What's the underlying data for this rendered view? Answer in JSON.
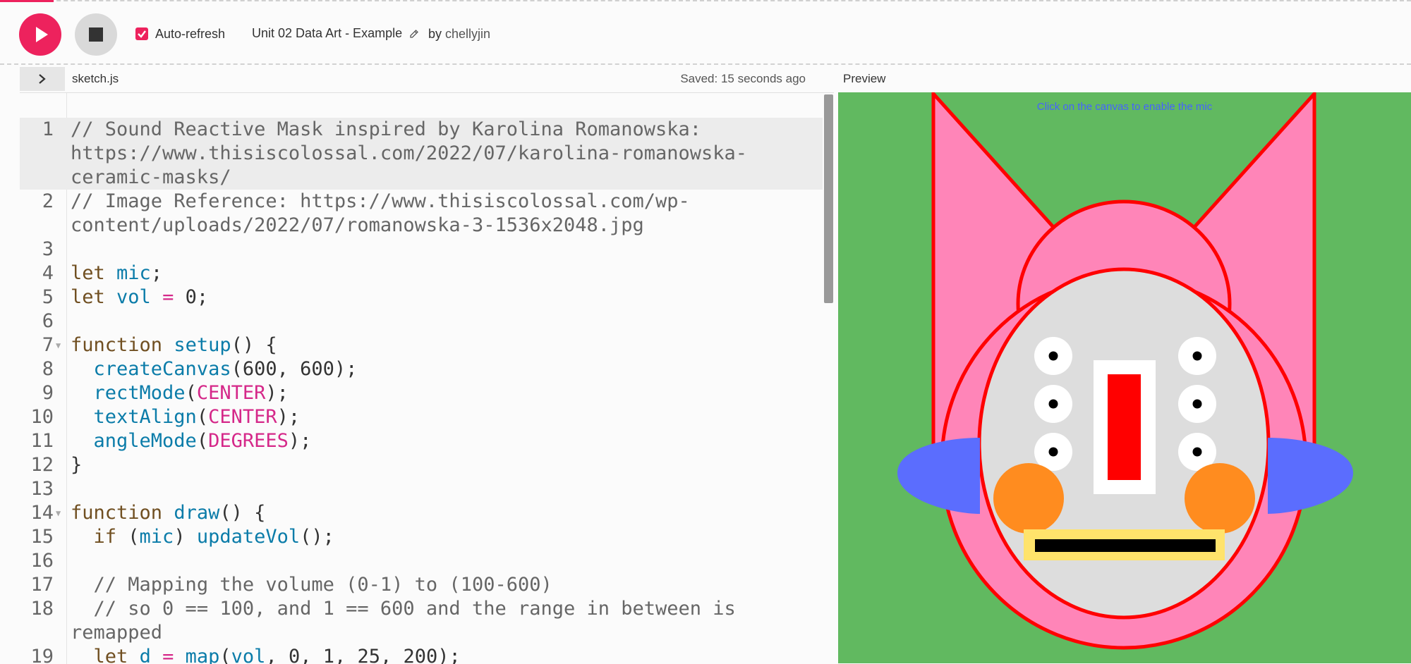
{
  "toolbar": {
    "auto_refresh_label": "Auto-refresh",
    "auto_refresh_checked": true,
    "project_title": "Unit 02 Data Art - Example",
    "by_label": "by",
    "author": "chellyjin",
    "colors": {
      "accent": "#ed225d",
      "stop_bg": "#d9d9d9"
    }
  },
  "editor": {
    "file_name": "sketch.js",
    "saved_status": "Saved: 15 seconds ago",
    "lines": [
      {
        "n": "1",
        "tokens": [
          {
            "t": "// Sound Reactive Mask inspired by Karolina Romanowska: https://www.thisiscolossal.com/2022/07/karolina-romanowska-ceramic-masks/",
            "c": "com"
          }
        ]
      },
      {
        "n": "2",
        "tokens": [
          {
            "t": "// Image Reference: https://www.thisiscolossal.com/wp-content/uploads/2022/07/romanowska-3-1536x2048.jpg",
            "c": "com"
          }
        ]
      },
      {
        "n": "3",
        "tokens": []
      },
      {
        "n": "4",
        "tokens": [
          {
            "t": "let",
            "c": "kw"
          },
          {
            "t": " ",
            "c": "txt"
          },
          {
            "t": "mic",
            "c": "var"
          },
          {
            "t": ";",
            "c": "txt"
          }
        ]
      },
      {
        "n": "5",
        "tokens": [
          {
            "t": "let",
            "c": "kw"
          },
          {
            "t": " ",
            "c": "txt"
          },
          {
            "t": "vol",
            "c": "var"
          },
          {
            "t": " ",
            "c": "txt"
          },
          {
            "t": "=",
            "c": "op"
          },
          {
            "t": " 0;",
            "c": "txt"
          }
        ]
      },
      {
        "n": "6",
        "tokens": []
      },
      {
        "n": "7",
        "fold": true,
        "tokens": [
          {
            "t": "function",
            "c": "kw"
          },
          {
            "t": " ",
            "c": "txt"
          },
          {
            "t": "setup",
            "c": "fn"
          },
          {
            "t": "() {",
            "c": "txt"
          }
        ]
      },
      {
        "n": "8",
        "tokens": [
          {
            "t": "  ",
            "c": "txt"
          },
          {
            "t": "createCanvas",
            "c": "fn"
          },
          {
            "t": "(600, 600);",
            "c": "txt"
          }
        ]
      },
      {
        "n": "9",
        "tokens": [
          {
            "t": "  ",
            "c": "txt"
          },
          {
            "t": "rectMode",
            "c": "fn"
          },
          {
            "t": "(",
            "c": "txt"
          },
          {
            "t": "CENTER",
            "c": "const"
          },
          {
            "t": ");",
            "c": "txt"
          }
        ]
      },
      {
        "n": "10",
        "tokens": [
          {
            "t": "  ",
            "c": "txt"
          },
          {
            "t": "textAlign",
            "c": "fn"
          },
          {
            "t": "(",
            "c": "txt"
          },
          {
            "t": "CENTER",
            "c": "const"
          },
          {
            "t": ");",
            "c": "txt"
          }
        ]
      },
      {
        "n": "11",
        "tokens": [
          {
            "t": "  ",
            "c": "txt"
          },
          {
            "t": "angleMode",
            "c": "fn"
          },
          {
            "t": "(",
            "c": "txt"
          },
          {
            "t": "DEGREES",
            "c": "const"
          },
          {
            "t": ");",
            "c": "txt"
          }
        ]
      },
      {
        "n": "12",
        "tokens": [
          {
            "t": "}",
            "c": "txt"
          }
        ]
      },
      {
        "n": "13",
        "tokens": []
      },
      {
        "n": "14",
        "fold": true,
        "tokens": [
          {
            "t": "function",
            "c": "kw"
          },
          {
            "t": " ",
            "c": "txt"
          },
          {
            "t": "draw",
            "c": "fn"
          },
          {
            "t": "() {",
            "c": "txt"
          }
        ]
      },
      {
        "n": "15",
        "tokens": [
          {
            "t": "  ",
            "c": "txt"
          },
          {
            "t": "if",
            "c": "kw"
          },
          {
            "t": " (",
            "c": "txt"
          },
          {
            "t": "mic",
            "c": "var"
          },
          {
            "t": ") ",
            "c": "txt"
          },
          {
            "t": "updateVol",
            "c": "fn"
          },
          {
            "t": "();",
            "c": "txt"
          }
        ]
      },
      {
        "n": "16",
        "tokens": []
      },
      {
        "n": "17",
        "tokens": [
          {
            "t": "  // Mapping the volume (0-1) to (100-600)",
            "c": "com"
          }
        ]
      },
      {
        "n": "18",
        "tokens": [
          {
            "t": "  // so 0 == 100, and 1 == 600 and the range in between is remapped",
            "c": "com"
          }
        ]
      },
      {
        "n": "19",
        "tokens": [
          {
            "t": "  ",
            "c": "txt"
          },
          {
            "t": "let",
            "c": "kw"
          },
          {
            "t": " ",
            "c": "txt"
          },
          {
            "t": "d",
            "c": "var"
          },
          {
            "t": " ",
            "c": "txt"
          },
          {
            "t": "=",
            "c": "op"
          },
          {
            "t": " ",
            "c": "txt"
          },
          {
            "t": "map",
            "c": "fn"
          },
          {
            "t": "(",
            "c": "txt"
          },
          {
            "t": "vol",
            "c": "var"
          },
          {
            "t": ", 0, 1, 25, 200);",
            "c": "txt"
          }
        ]
      }
    ]
  },
  "preview": {
    "label": "Preview",
    "mic_prompt": "Click on the canvas to enable the mic",
    "colors": {
      "background": "#61b960",
      "mask_pink": "#ff85b8",
      "outline_red": "#ff0000",
      "face_gray": "#dddddd",
      "ear_blue": "#5b6dfe",
      "cheek_orange": "#ff8c1f",
      "mouth_yellow": "#ffe36b"
    }
  }
}
